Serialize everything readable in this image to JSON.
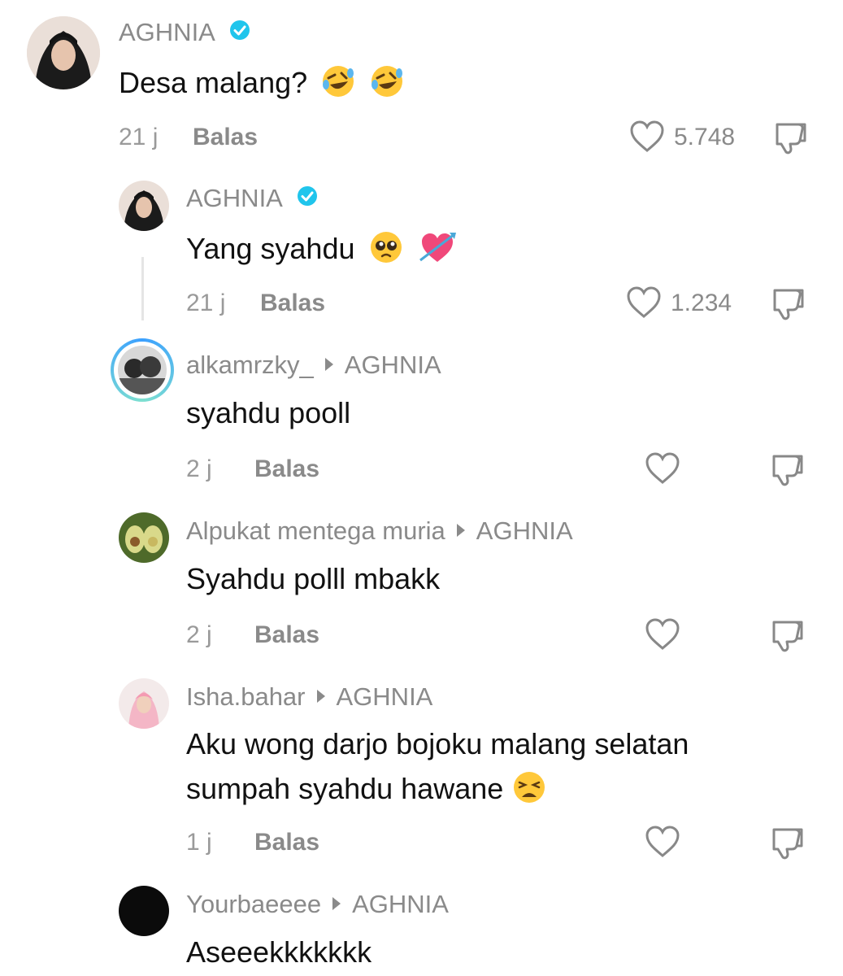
{
  "comments": [
    {
      "username": "AGHNIA",
      "verified": true,
      "text": "Desa malang?",
      "emojis": [
        "rolling-on-floor-laughing",
        "rolling-on-floor-laughing"
      ],
      "time": "21 j",
      "reply_label": "Balas",
      "likes": "5.748"
    },
    {
      "username": "AGHNIA",
      "verified": true,
      "text": "Yang syahdu",
      "emojis": [
        "pleading-face",
        "heart-with-arrow"
      ],
      "time": "21 j",
      "reply_label": "Balas",
      "likes": "1.234"
    },
    {
      "username": "alkamrzky_",
      "reply_to": "AGHNIA",
      "text": "syahdu pooll",
      "time": "2 j",
      "reply_label": "Balas",
      "likes": ""
    },
    {
      "username": "Alpukat mentega muria",
      "reply_to": "AGHNIA",
      "text": "Syahdu polll mbakk",
      "time": "2 j",
      "reply_label": "Balas",
      "likes": ""
    },
    {
      "username": "Isha.bahar",
      "reply_to": "AGHNIA",
      "text_line1": "Aku wong darjo bojoku malang selatan",
      "text_line2": "sumpah syahdu hawane",
      "emojis": [
        "weary-face"
      ],
      "time": "1 j",
      "reply_label": "Balas",
      "likes": ""
    },
    {
      "username": "Yourbaeeee",
      "reply_to": "AGHNIA",
      "text": "Aseeekkkkkkk"
    }
  ],
  "colors": {
    "verified": "#20c5ec",
    "text": "#111111",
    "muted": "#8a8a8a"
  },
  "icons": [
    "heart-outline-icon",
    "thumbs-down-icon",
    "verified-badge-icon",
    "reply-arrow-icon"
  ]
}
